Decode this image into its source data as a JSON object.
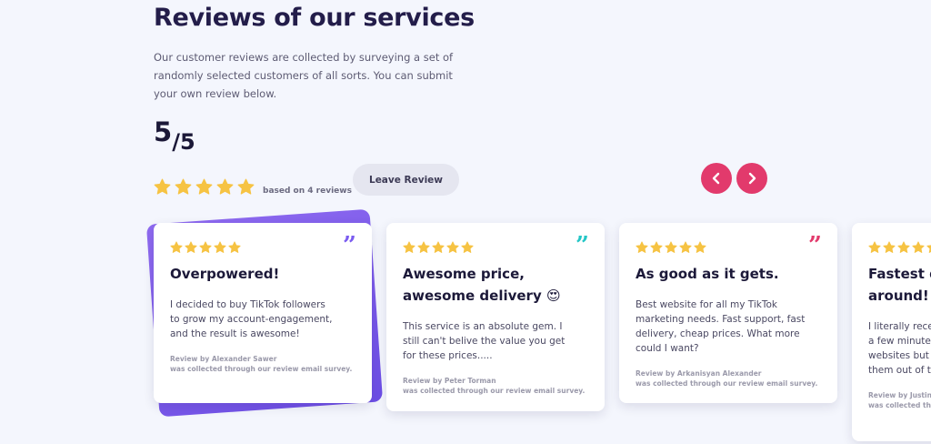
{
  "header": {
    "title": "Reviews of our services",
    "description": "Our customer reviews are collected by surveying a set of randomly selected customers of all sorts. You can submit your own review below."
  },
  "summary": {
    "score": "5",
    "score_max": "/5",
    "rating": 5,
    "based_on": "based on 4 reviews",
    "leave_review_label": "Leave Review"
  },
  "colors": {
    "star": "#f6c343",
    "accent": "#e23a6c",
    "purple": "#7b5cf0",
    "teal": "#24c6c6",
    "pink": "#e23a6c",
    "star_icon": "star-icon"
  },
  "navigation": {
    "prev_icon": "chevron-left-icon",
    "next_icon": "chevron-right-icon"
  },
  "reviews": [
    {
      "rating": 5,
      "title": "Overpowered!",
      "body": "I decided to buy TikTok followers to grow my account-engagement, and the result is awesome!",
      "reviewer": "Review by Alexander Sawer",
      "note": "was collected through our review email survey.",
      "quote_color": "#7b5cf0"
    },
    {
      "rating": 5,
      "title": "Awesome price, awesome delivery 😍",
      "body": "This service is an absolute gem. I still can't belive the value you get for these prices.....",
      "reviewer": "Review by Peter Torman",
      "note": "was collected through our review email survey.",
      "quote_color": "#24c6c6"
    },
    {
      "rating": 5,
      "title": "As good as it gets.",
      "body": "Best website for all my TikTok marketing needs. Fast support, fast delivery, cheap prices. What more could I want?",
      "reviewer": "Review by Arkanisyan Alexander",
      "note": "was collected through our review email survey.",
      "quote_color": "#e23a6c"
    },
    {
      "rating": 5,
      "title": "Fastest delivery around!",
      "body": "I literally received my order in a few minutes. Tried other websites but this one blows them out of the water!",
      "reviewer": "Review by Justin",
      "note": "was collected through our review email survey.",
      "quote_color": "#f6c343"
    }
  ]
}
